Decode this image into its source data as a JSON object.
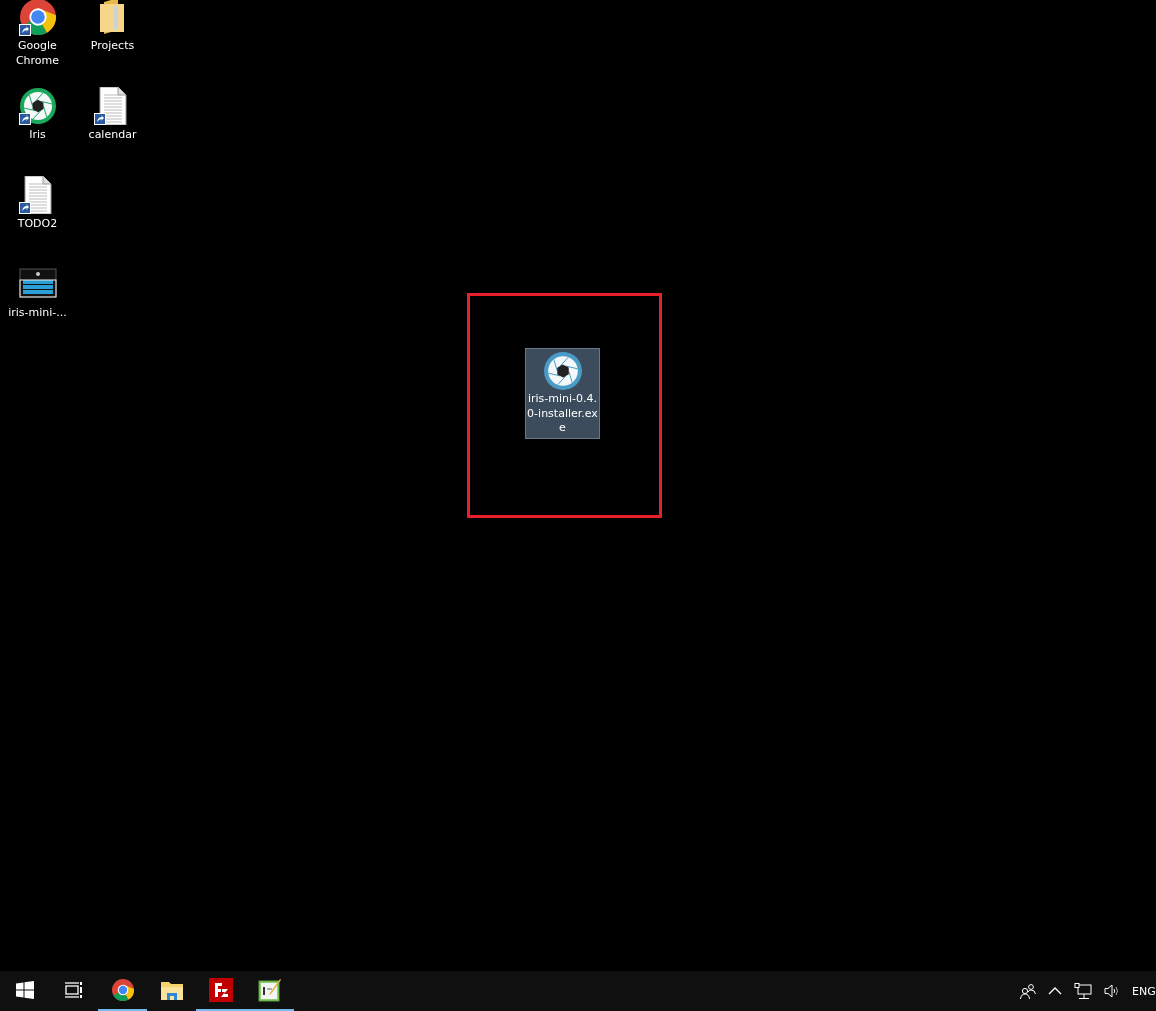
{
  "desktop": {
    "icon_rows": [
      [
        {
          "kind": "chrome",
          "label": "Google Chrome",
          "shortcut": true
        },
        {
          "kind": "folder",
          "label": "Projects",
          "shortcut": false
        }
      ],
      [
        {
          "kind": "iris",
          "label": "Iris",
          "shortcut": true
        },
        {
          "kind": "document",
          "label": "calendar",
          "shortcut": true
        }
      ],
      [
        {
          "kind": "document",
          "label": "TODO2",
          "shortcut": true
        }
      ],
      [
        {
          "kind": "thumbnail",
          "label": "iris-mini-...",
          "shortcut": false
        }
      ]
    ],
    "highlighted_file": {
      "kind": "iris-installer",
      "label": "iris-mini-0.4.0-installer.exe",
      "selected": true
    }
  },
  "taskbar": {
    "items": [
      {
        "kind": "start",
        "running": false
      },
      {
        "kind": "taskview",
        "running": false
      },
      {
        "kind": "chrome",
        "running": true
      },
      {
        "kind": "explorer",
        "running": false
      },
      {
        "kind": "filezilla",
        "running": true
      },
      {
        "kind": "notepad",
        "running": true
      }
    ],
    "tray": {
      "language": "ENG"
    }
  }
}
